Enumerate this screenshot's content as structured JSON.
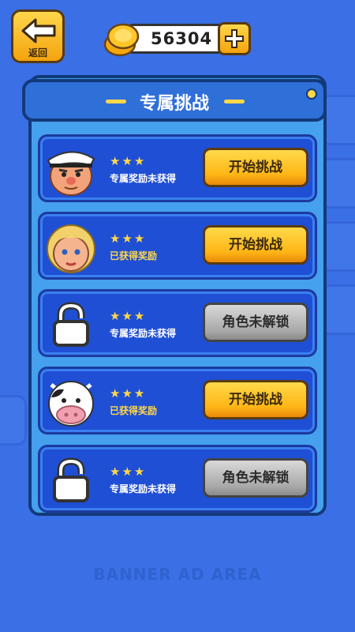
{
  "top_bar": {
    "back_label": "返回",
    "coins": "56304"
  },
  "panel": {
    "title": "专属挑战"
  },
  "rows": [
    {
      "avatar": "captain-character",
      "stars": "★★★",
      "status": "专属奖励未获得",
      "status_type": "none",
      "button": "开始挑战",
      "button_type": "start"
    },
    {
      "avatar": "blonde-girl-character",
      "stars": "★★★",
      "status": "已获得奖励",
      "status_type": "got",
      "button": "开始挑战",
      "button_type": "start"
    },
    {
      "avatar": "lock-icon",
      "stars": "★★★",
      "status": "专属奖励未获得",
      "status_type": "none",
      "button": "角色未解锁",
      "button_type": "locked"
    },
    {
      "avatar": "cow-character",
      "stars": "★★★",
      "status": "已获得奖励",
      "status_type": "got",
      "button": "开始挑战",
      "button_type": "start"
    },
    {
      "avatar": "lock-icon",
      "stars": "★★★",
      "status": "专属奖励未获得",
      "status_type": "none",
      "button": "角色未解锁",
      "button_type": "locked"
    }
  ],
  "ad": {
    "text": "BANNER AD AREA"
  },
  "colors": {
    "background": "#3a6fe6",
    "panel": "#45a0ee",
    "row": "#1f4fd4",
    "accent_yellow": "#ffd84a"
  }
}
